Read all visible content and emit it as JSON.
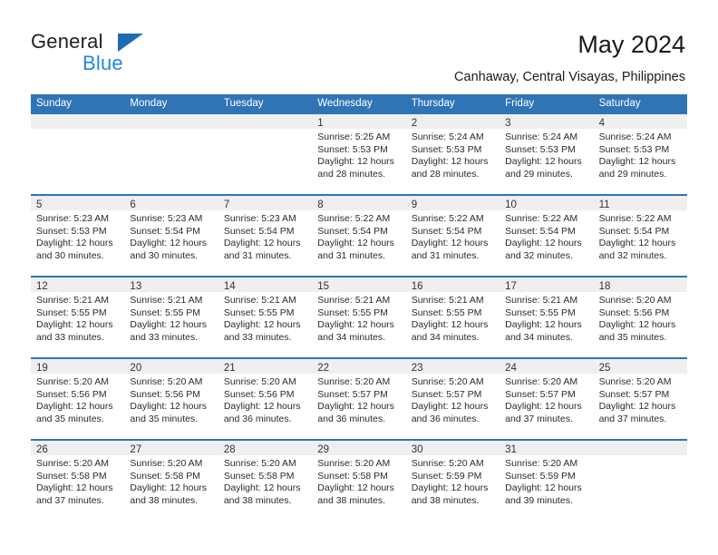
{
  "brand": {
    "name_top": "General",
    "name_bottom": "Blue",
    "triangle_color": "#1c6cb4",
    "bottom_color": "#1f87dd"
  },
  "header": {
    "title": "May 2024",
    "subtitle": "Canhaway, Central Visayas, Philippines"
  },
  "theme": {
    "header_blue": "#2f74b5",
    "band_gray": "#efefef"
  },
  "weekdays": [
    "Sunday",
    "Monday",
    "Tuesday",
    "Wednesday",
    "Thursday",
    "Friday",
    "Saturday"
  ],
  "weeks": [
    [
      {
        "day": "",
        "sunrise": "",
        "sunset": "",
        "daylight_line1": "",
        "daylight_line2": ""
      },
      {
        "day": "",
        "sunrise": "",
        "sunset": "",
        "daylight_line1": "",
        "daylight_line2": ""
      },
      {
        "day": "",
        "sunrise": "",
        "sunset": "",
        "daylight_line1": "",
        "daylight_line2": ""
      },
      {
        "day": "1",
        "sunrise": "Sunrise: 5:25 AM",
        "sunset": "Sunset: 5:53 PM",
        "daylight_line1": "Daylight: 12 hours",
        "daylight_line2": "and 28 minutes."
      },
      {
        "day": "2",
        "sunrise": "Sunrise: 5:24 AM",
        "sunset": "Sunset: 5:53 PM",
        "daylight_line1": "Daylight: 12 hours",
        "daylight_line2": "and 28 minutes."
      },
      {
        "day": "3",
        "sunrise": "Sunrise: 5:24 AM",
        "sunset": "Sunset: 5:53 PM",
        "daylight_line1": "Daylight: 12 hours",
        "daylight_line2": "and 29 minutes."
      },
      {
        "day": "4",
        "sunrise": "Sunrise: 5:24 AM",
        "sunset": "Sunset: 5:53 PM",
        "daylight_line1": "Daylight: 12 hours",
        "daylight_line2": "and 29 minutes."
      }
    ],
    [
      {
        "day": "5",
        "sunrise": "Sunrise: 5:23 AM",
        "sunset": "Sunset: 5:53 PM",
        "daylight_line1": "Daylight: 12 hours",
        "daylight_line2": "and 30 minutes."
      },
      {
        "day": "6",
        "sunrise": "Sunrise: 5:23 AM",
        "sunset": "Sunset: 5:54 PM",
        "daylight_line1": "Daylight: 12 hours",
        "daylight_line2": "and 30 minutes."
      },
      {
        "day": "7",
        "sunrise": "Sunrise: 5:23 AM",
        "sunset": "Sunset: 5:54 PM",
        "daylight_line1": "Daylight: 12 hours",
        "daylight_line2": "and 31 minutes."
      },
      {
        "day": "8",
        "sunrise": "Sunrise: 5:22 AM",
        "sunset": "Sunset: 5:54 PM",
        "daylight_line1": "Daylight: 12 hours",
        "daylight_line2": "and 31 minutes."
      },
      {
        "day": "9",
        "sunrise": "Sunrise: 5:22 AM",
        "sunset": "Sunset: 5:54 PM",
        "daylight_line1": "Daylight: 12 hours",
        "daylight_line2": "and 31 minutes."
      },
      {
        "day": "10",
        "sunrise": "Sunrise: 5:22 AM",
        "sunset": "Sunset: 5:54 PM",
        "daylight_line1": "Daylight: 12 hours",
        "daylight_line2": "and 32 minutes."
      },
      {
        "day": "11",
        "sunrise": "Sunrise: 5:22 AM",
        "sunset": "Sunset: 5:54 PM",
        "daylight_line1": "Daylight: 12 hours",
        "daylight_line2": "and 32 minutes."
      }
    ],
    [
      {
        "day": "12",
        "sunrise": "Sunrise: 5:21 AM",
        "sunset": "Sunset: 5:55 PM",
        "daylight_line1": "Daylight: 12 hours",
        "daylight_line2": "and 33 minutes."
      },
      {
        "day": "13",
        "sunrise": "Sunrise: 5:21 AM",
        "sunset": "Sunset: 5:55 PM",
        "daylight_line1": "Daylight: 12 hours",
        "daylight_line2": "and 33 minutes."
      },
      {
        "day": "14",
        "sunrise": "Sunrise: 5:21 AM",
        "sunset": "Sunset: 5:55 PM",
        "daylight_line1": "Daylight: 12 hours",
        "daylight_line2": "and 33 minutes."
      },
      {
        "day": "15",
        "sunrise": "Sunrise: 5:21 AM",
        "sunset": "Sunset: 5:55 PM",
        "daylight_line1": "Daylight: 12 hours",
        "daylight_line2": "and 34 minutes."
      },
      {
        "day": "16",
        "sunrise": "Sunrise: 5:21 AM",
        "sunset": "Sunset: 5:55 PM",
        "daylight_line1": "Daylight: 12 hours",
        "daylight_line2": "and 34 minutes."
      },
      {
        "day": "17",
        "sunrise": "Sunrise: 5:21 AM",
        "sunset": "Sunset: 5:55 PM",
        "daylight_line1": "Daylight: 12 hours",
        "daylight_line2": "and 34 minutes."
      },
      {
        "day": "18",
        "sunrise": "Sunrise: 5:20 AM",
        "sunset": "Sunset: 5:56 PM",
        "daylight_line1": "Daylight: 12 hours",
        "daylight_line2": "and 35 minutes."
      }
    ],
    [
      {
        "day": "19",
        "sunrise": "Sunrise: 5:20 AM",
        "sunset": "Sunset: 5:56 PM",
        "daylight_line1": "Daylight: 12 hours",
        "daylight_line2": "and 35 minutes."
      },
      {
        "day": "20",
        "sunrise": "Sunrise: 5:20 AM",
        "sunset": "Sunset: 5:56 PM",
        "daylight_line1": "Daylight: 12 hours",
        "daylight_line2": "and 35 minutes."
      },
      {
        "day": "21",
        "sunrise": "Sunrise: 5:20 AM",
        "sunset": "Sunset: 5:56 PM",
        "daylight_line1": "Daylight: 12 hours",
        "daylight_line2": "and 36 minutes."
      },
      {
        "day": "22",
        "sunrise": "Sunrise: 5:20 AM",
        "sunset": "Sunset: 5:57 PM",
        "daylight_line1": "Daylight: 12 hours",
        "daylight_line2": "and 36 minutes."
      },
      {
        "day": "23",
        "sunrise": "Sunrise: 5:20 AM",
        "sunset": "Sunset: 5:57 PM",
        "daylight_line1": "Daylight: 12 hours",
        "daylight_line2": "and 36 minutes."
      },
      {
        "day": "24",
        "sunrise": "Sunrise: 5:20 AM",
        "sunset": "Sunset: 5:57 PM",
        "daylight_line1": "Daylight: 12 hours",
        "daylight_line2": "and 37 minutes."
      },
      {
        "day": "25",
        "sunrise": "Sunrise: 5:20 AM",
        "sunset": "Sunset: 5:57 PM",
        "daylight_line1": "Daylight: 12 hours",
        "daylight_line2": "and 37 minutes."
      }
    ],
    [
      {
        "day": "26",
        "sunrise": "Sunrise: 5:20 AM",
        "sunset": "Sunset: 5:58 PM",
        "daylight_line1": "Daylight: 12 hours",
        "daylight_line2": "and 37 minutes."
      },
      {
        "day": "27",
        "sunrise": "Sunrise: 5:20 AM",
        "sunset": "Sunset: 5:58 PM",
        "daylight_line1": "Daylight: 12 hours",
        "daylight_line2": "and 38 minutes."
      },
      {
        "day": "28",
        "sunrise": "Sunrise: 5:20 AM",
        "sunset": "Sunset: 5:58 PM",
        "daylight_line1": "Daylight: 12 hours",
        "daylight_line2": "and 38 minutes."
      },
      {
        "day": "29",
        "sunrise": "Sunrise: 5:20 AM",
        "sunset": "Sunset: 5:58 PM",
        "daylight_line1": "Daylight: 12 hours",
        "daylight_line2": "and 38 minutes."
      },
      {
        "day": "30",
        "sunrise": "Sunrise: 5:20 AM",
        "sunset": "Sunset: 5:59 PM",
        "daylight_line1": "Daylight: 12 hours",
        "daylight_line2": "and 38 minutes."
      },
      {
        "day": "31",
        "sunrise": "Sunrise: 5:20 AM",
        "sunset": "Sunset: 5:59 PM",
        "daylight_line1": "Daylight: 12 hours",
        "daylight_line2": "and 39 minutes."
      },
      {
        "day": "",
        "sunrise": "",
        "sunset": "",
        "daylight_line1": "",
        "daylight_line2": ""
      }
    ]
  ]
}
